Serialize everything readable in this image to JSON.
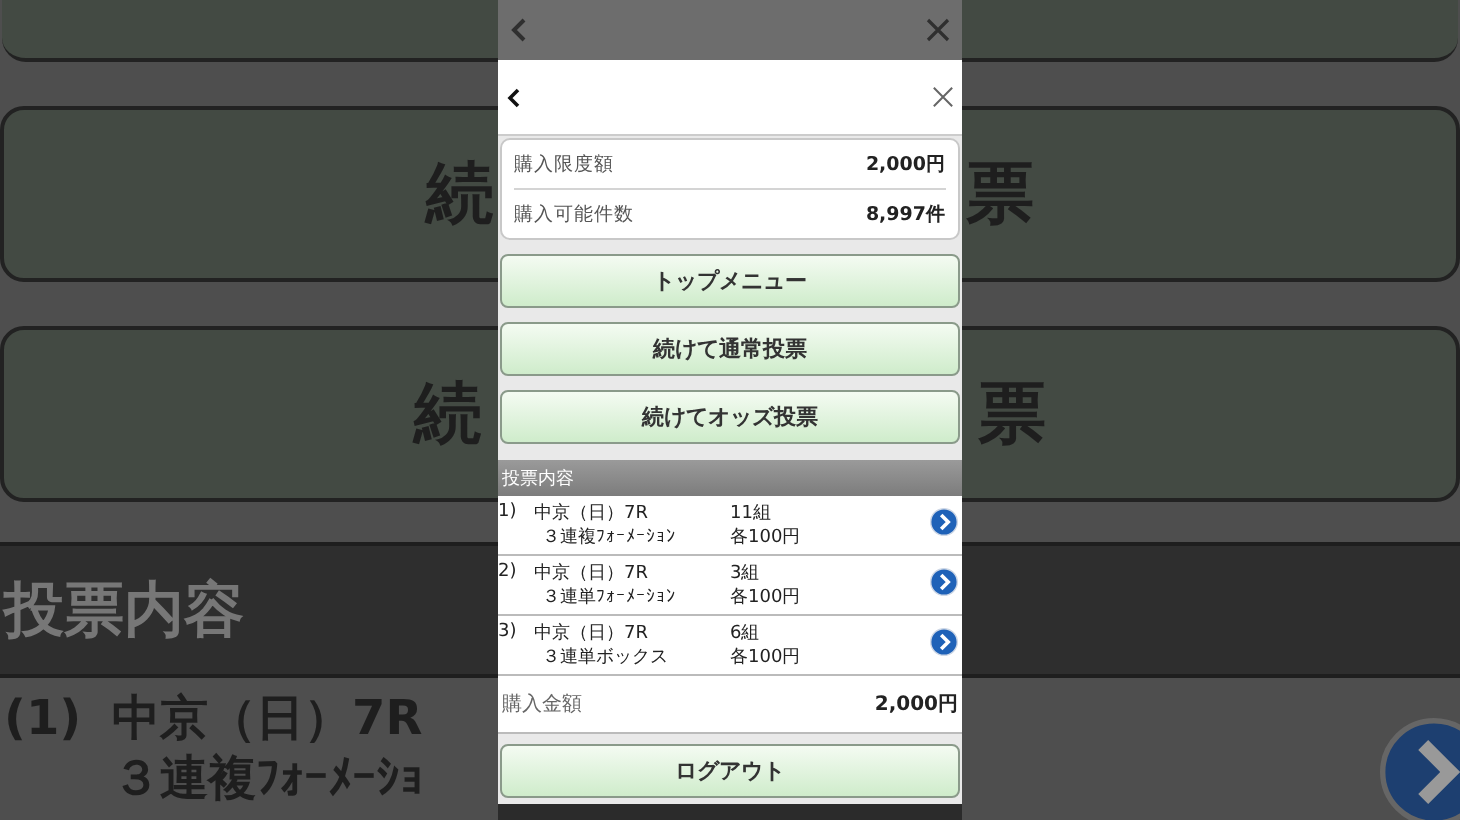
{
  "backdrop": {
    "buttons": [
      {
        "left": "続",
        "right": "票"
      },
      {
        "left": "続",
        "right": "票"
      }
    ],
    "section_title": "投票内容",
    "row": {
      "number": "(1)",
      "race": "中京（日）7R",
      "bet_type": "３連複ﾌｫｰﾒｰｼｮ"
    }
  },
  "info": [
    {
      "label": "購入限度額",
      "value": "2,000円"
    },
    {
      "label": "購入可能件数",
      "value": "8,997件"
    }
  ],
  "buttons": [
    "トップメニュー",
    "続けて通常投票",
    "続けてオッズ投票"
  ],
  "section_title": "投票内容",
  "bets": [
    {
      "number": "1)",
      "race": "中京（日）7R",
      "bet_type": "３連複ﾌｫｰﾒｰｼｮﾝ",
      "count": "11組",
      "price": "各100円"
    },
    {
      "number": "2)",
      "race": "中京（日）7R",
      "bet_type": "３連単ﾌｫｰﾒｰｼｮﾝ",
      "count": "3組",
      "price": "各100円"
    },
    {
      "number": "3)",
      "race": "中京（日）7R",
      "bet_type": "３連単ボックス",
      "count": "6組",
      "price": "各100円"
    }
  ],
  "total": {
    "label": "購入金額",
    "value": "2,000円"
  },
  "logout": "ログアウト"
}
